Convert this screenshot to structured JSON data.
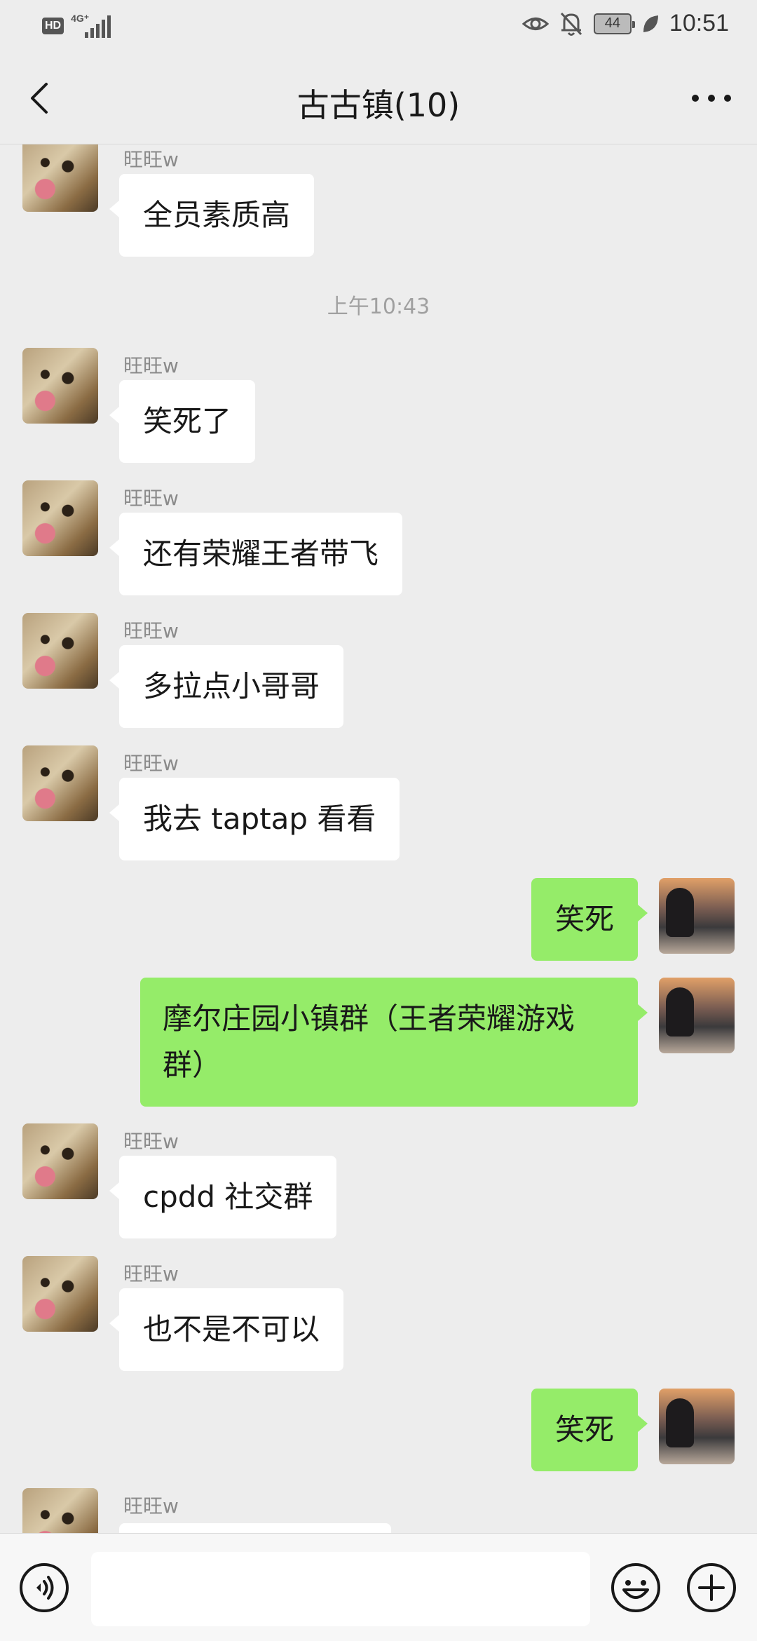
{
  "status_bar": {
    "left_badge": "HD",
    "network_type": "4G⁺",
    "battery_level": "44",
    "time": "10:51"
  },
  "nav": {
    "title": "古古镇(10)"
  },
  "messages": {
    "m0": {
      "sender": "旺旺w",
      "text": "全员素质高"
    },
    "timestamp": "上午10:43",
    "m1": {
      "sender": "旺旺w",
      "text": "笑死了"
    },
    "m2": {
      "sender": "旺旺w",
      "text": "还有荣耀王者带飞"
    },
    "m3": {
      "sender": "旺旺w",
      "text": "多拉点小哥哥"
    },
    "m4": {
      "sender": "旺旺w",
      "text": "我去 taptap 看看"
    },
    "m5": {
      "text": "笑死"
    },
    "m6": {
      "text": "摩尔庄园小镇群（王者荣耀游戏\n群）"
    },
    "m7": {
      "sender": "旺旺w",
      "text": "cpdd 社交群"
    },
    "m8": {
      "sender": "旺旺w",
      "text": "也不是不可以"
    },
    "m9": {
      "text": "笑死"
    },
    "m10": {
      "sender": "旺旺w",
      "text": ""
    }
  },
  "input_bar": {
    "text_value": "",
    "icons": [
      "voice-icon",
      "emoji-icon",
      "plus-icon"
    ]
  },
  "colors": {
    "background": "#ededed",
    "incoming_bubble": "#ffffff",
    "outgoing_bubble": "#95ec69"
  }
}
